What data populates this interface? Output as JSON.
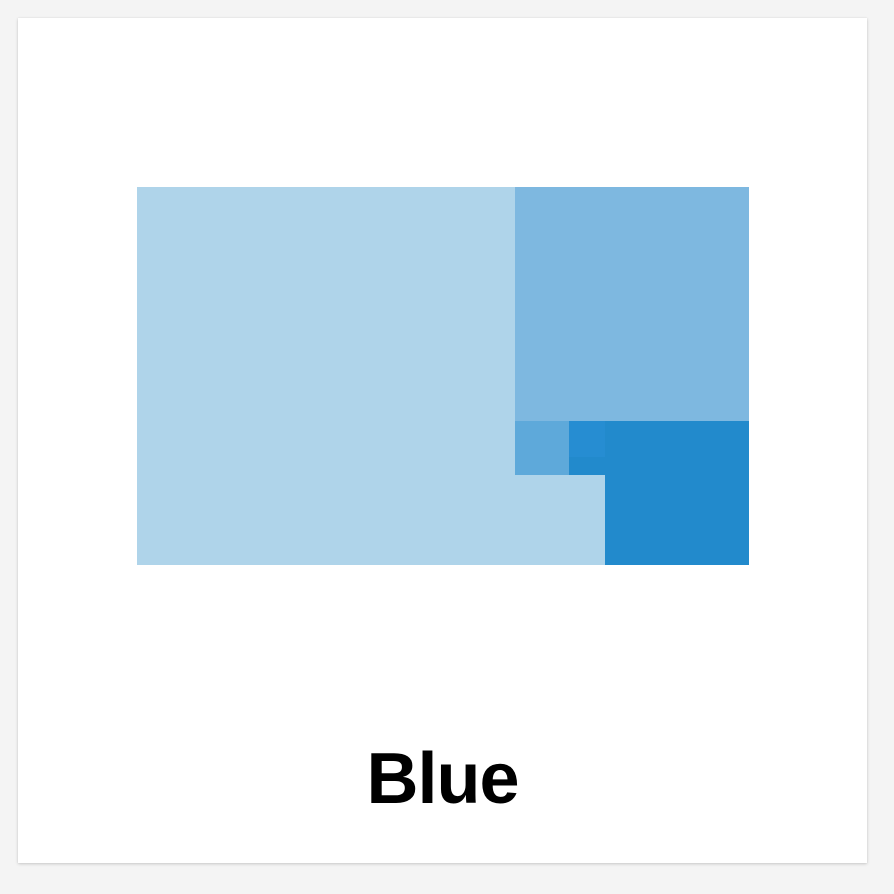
{
  "card": {
    "label": "Blue"
  },
  "swatches": [
    {
      "name": "light-blue-1",
      "color": "#afd4ea"
    },
    {
      "name": "medium-blue-2",
      "color": "#7eb8e0"
    },
    {
      "name": "strong-blue-3",
      "color": "#228acc"
    },
    {
      "name": "light-blue-4",
      "color": "#afd4ea"
    },
    {
      "name": "medium-blue-5",
      "color": "#5ea9da"
    },
    {
      "name": "bright-blue-6",
      "color": "#268dd2"
    },
    {
      "name": "strong-blue-7",
      "color": "#228acc"
    }
  ]
}
